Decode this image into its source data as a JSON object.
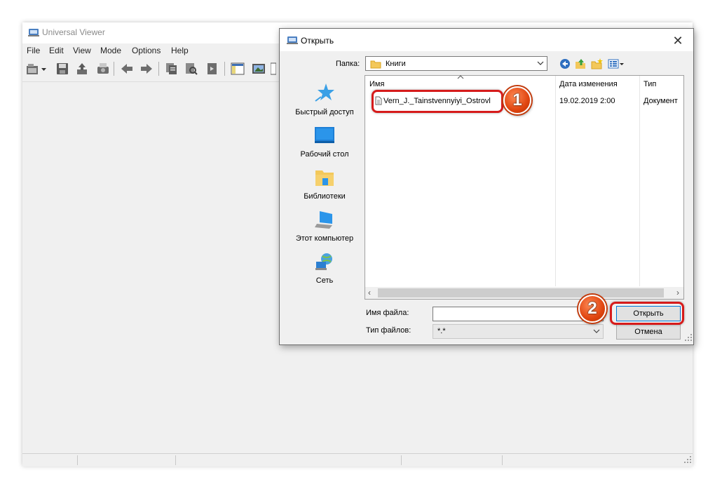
{
  "app": {
    "title": "Universal Viewer",
    "menu": [
      "File",
      "Edit",
      "View",
      "Mode",
      "Options",
      "Help"
    ]
  },
  "dialog": {
    "title": "Открыть",
    "close_glyph": "✕",
    "look_in_label": "Папка:",
    "look_in_value": "Книги",
    "places": [
      "Быстрый доступ",
      "Рабочий стол",
      "Библиотеки",
      "Этот компьютер",
      "Сеть"
    ],
    "columns": {
      "name": "Имя",
      "date": "Дата изменения",
      "type": "Тип"
    },
    "files": [
      {
        "name": "Vern_J._Tainstvennyiyi_Ostrovl",
        "date": "19.02.2019 2:00",
        "type": "Документ"
      }
    ],
    "file_name_label": "Имя файла:",
    "file_name_value": "",
    "file_type_label": "Тип файлов:",
    "file_type_value": "*.*",
    "open_label": "Открыть",
    "cancel_label": "Отмена"
  },
  "annotations": {
    "badge_1": "1",
    "badge_2": "2",
    "highlight_color": "#d61b1b",
    "badge_color": "#e04510"
  },
  "icons": [
    "app-icon",
    "open-icon",
    "save-icon",
    "print-icon",
    "prev-icon",
    "next-icon",
    "copy-icon",
    "find-icon",
    "star-icon",
    "desktop-icon",
    "libraries-icon",
    "computer-icon",
    "network-icon",
    "folder-icon",
    "back-icon",
    "up-icon",
    "new-folder-icon",
    "view-menu-icon"
  ]
}
